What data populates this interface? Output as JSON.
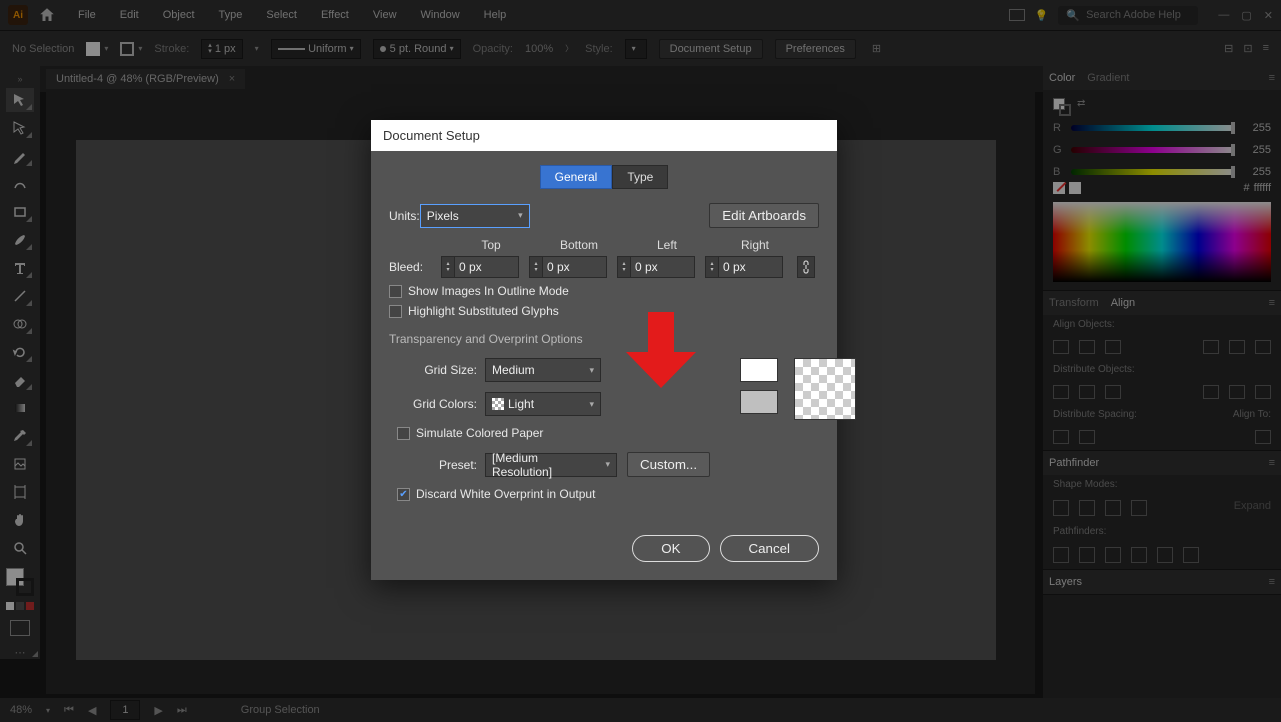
{
  "menubar": {
    "items": [
      "File",
      "Edit",
      "Object",
      "Type",
      "Select",
      "Effect",
      "View",
      "Window",
      "Help"
    ],
    "search_placeholder": "Search Adobe Help"
  },
  "controlbar": {
    "selection": "No Selection",
    "stroke_label": "Stroke:",
    "stroke_val": "1 px",
    "uniform": "Uniform",
    "cap_label": "5 pt. Round",
    "opacity_label": "Opacity:",
    "opacity_val": "100%",
    "style_label": "Style:",
    "docsetup_btn": "Document Setup",
    "prefs_btn": "Preferences"
  },
  "doctab": {
    "title": "Untitled-4 @ 48% (RGB/Preview)"
  },
  "color_panel": {
    "tabs": [
      "Color",
      "Gradient"
    ],
    "r": "255",
    "g": "255",
    "b": "255",
    "hex_prefix": "#",
    "hex": "ffffff"
  },
  "transform_align": {
    "tabs": [
      "Transform",
      "Align"
    ],
    "align_objects": "Align Objects:",
    "distribute_objects": "Distribute Objects:",
    "distribute_spacing": "Distribute Spacing:",
    "align_to": "Align To:"
  },
  "pathfinder": {
    "title": "Pathfinder",
    "shape_modes": "Shape Modes:",
    "expand": "Expand",
    "pathfinders": "Pathfinders:"
  },
  "layers": {
    "title": "Layers"
  },
  "statusbar": {
    "zoom": "48%",
    "mode": "Group Selection"
  },
  "dialog": {
    "title": "Document Setup",
    "tab_general": "General",
    "tab_type": "Type",
    "units_label": "Units:",
    "units_value": "Pixels",
    "edit_artboards": "Edit Artboards",
    "bleed_label": "Bleed:",
    "bleed_heads": {
      "top": "Top",
      "bottom": "Bottom",
      "left": "Left",
      "right": "Right"
    },
    "bleed_vals": {
      "top": "0 px",
      "bottom": "0 px",
      "left": "0 px",
      "right": "0 px"
    },
    "chk_outline": "Show Images In Outline Mode",
    "chk_glyphs": "Highlight Substituted Glyphs",
    "section_transparency": "Transparency and Overprint Options",
    "grid_size_label": "Grid Size:",
    "grid_size_value": "Medium",
    "grid_colors_label": "Grid Colors:",
    "grid_colors_value": "Light",
    "chk_simulate": "Simulate Colored Paper",
    "preset_label": "Preset:",
    "preset_value": "[Medium Resolution]",
    "custom_btn": "Custom...",
    "chk_discard": "Discard White Overprint in Output",
    "ok": "OK",
    "cancel": "Cancel"
  }
}
